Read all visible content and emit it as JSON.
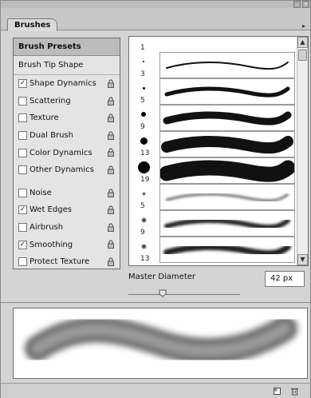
{
  "panel": {
    "tab_label": "Brushes",
    "presets_label": "Brush Presets",
    "tip_shape_label": "Brush Tip Shape"
  },
  "options": [
    {
      "label": "Shape Dynamics",
      "checked": true,
      "lock": true
    },
    {
      "label": "Scattering",
      "checked": false,
      "lock": true
    },
    {
      "label": "Texture",
      "checked": false,
      "lock": true
    },
    {
      "label": "Dual Brush",
      "checked": false,
      "lock": true
    },
    {
      "label": "Color Dynamics",
      "checked": false,
      "lock": true
    },
    {
      "label": "Other Dynamics",
      "checked": false,
      "lock": true
    },
    {
      "label": "Noise",
      "checked": false,
      "lock": true
    },
    {
      "label": "Wet Edges",
      "checked": true,
      "lock": true
    },
    {
      "label": "Airbrush",
      "checked": false,
      "lock": true
    },
    {
      "label": "Smoothing",
      "checked": true,
      "lock": true
    },
    {
      "label": "Protect Texture",
      "checked": false,
      "lock": true
    }
  ],
  "brushes": [
    {
      "size": "1"
    },
    {
      "size": "3"
    },
    {
      "size": "5"
    },
    {
      "size": "9"
    },
    {
      "size": "13"
    },
    {
      "size": "19"
    },
    {
      "size": "5"
    },
    {
      "size": "9"
    },
    {
      "size": "13"
    }
  ],
  "master_diameter": {
    "label": "Master Diameter",
    "value": "42 px",
    "slider_fraction": 0.31
  },
  "icons": {
    "panel_close": "close-icon",
    "panel_collapse": "collapse-icon",
    "tab_menu": "menu-arrow-icon",
    "new_brush": "new-brush-icon",
    "delete_brush": "trash-icon"
  },
  "colors": {
    "panel_bg": "#d4d4d4",
    "stroke": "#111111"
  }
}
